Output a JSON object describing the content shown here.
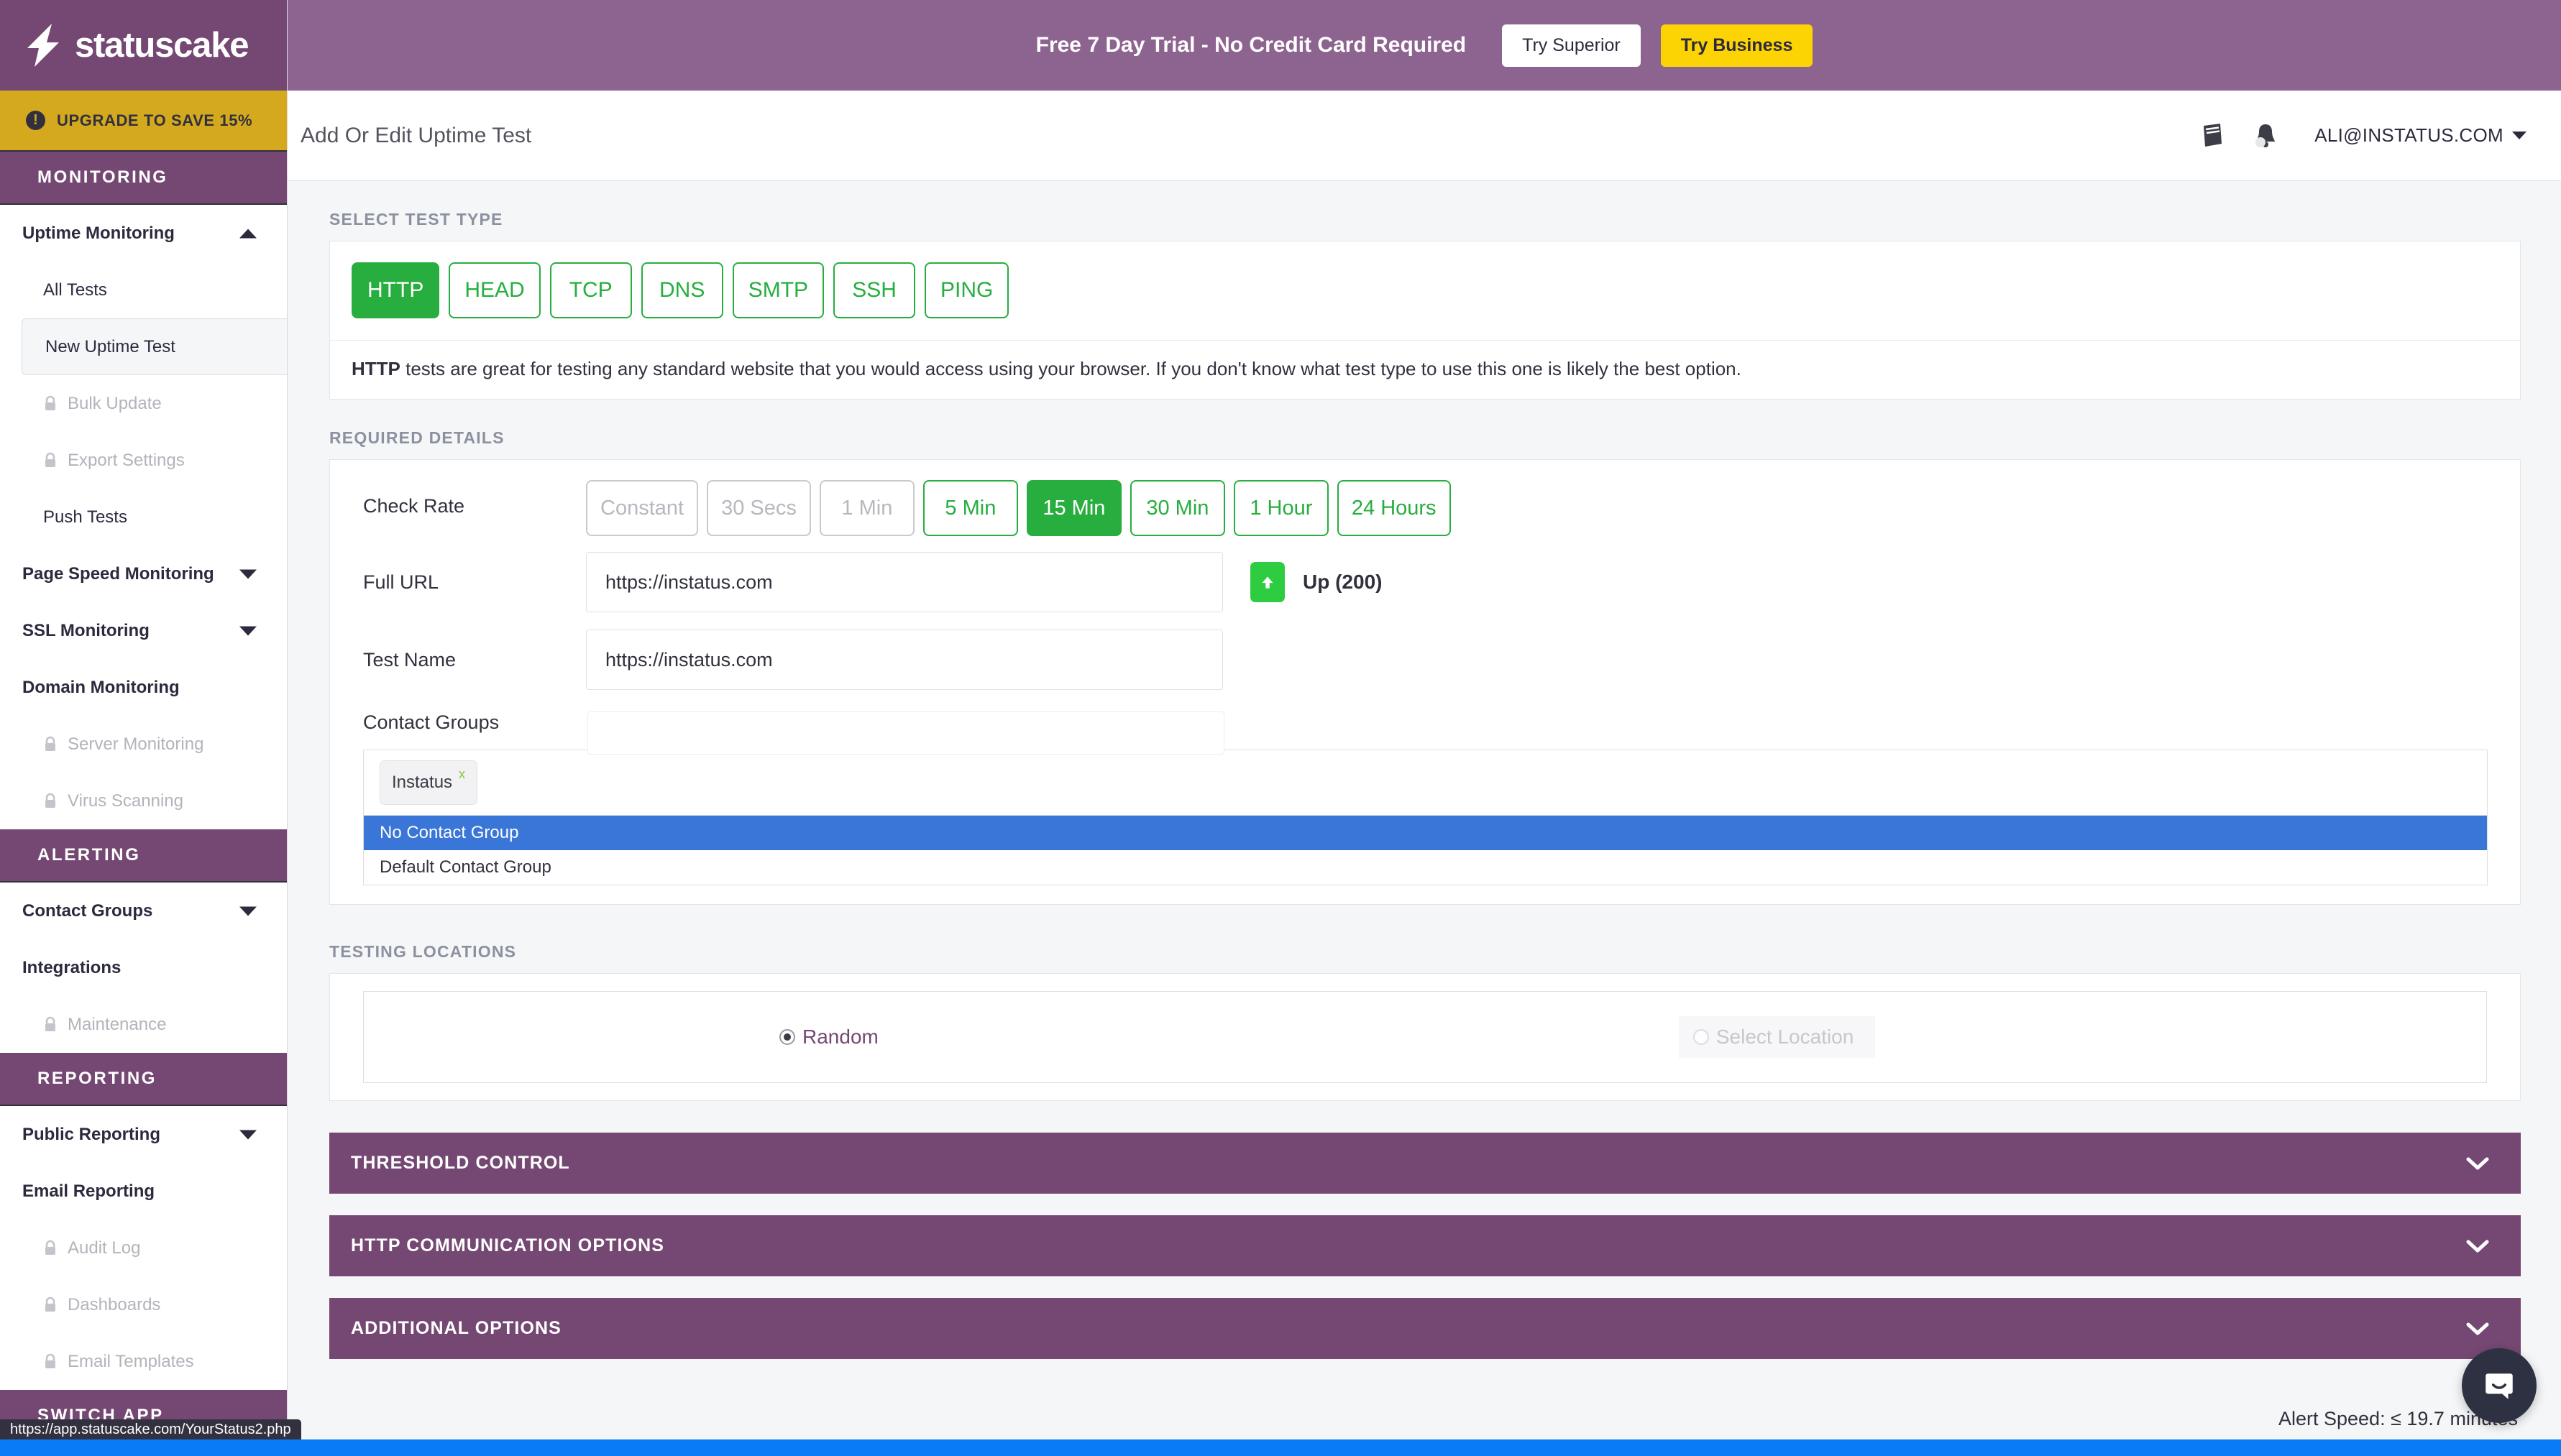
{
  "brand": {
    "name": "statuscake",
    "purple": "#744873",
    "gold": "#d4a91e",
    "green": "#27ae3f",
    "blue": "#3a76d8"
  },
  "sidebar": {
    "upgrade_label": "UPGRADE TO SAVE 15%",
    "groups": [
      {
        "heading": "MONITORING",
        "items": [
          {
            "label": "Uptime Monitoring",
            "level": "top",
            "caret": "up",
            "locked": false,
            "active": false
          },
          {
            "label": "All Tests",
            "level": "sub",
            "caret": "none",
            "locked": false,
            "active": false
          },
          {
            "label": "New Uptime Test",
            "level": "sub",
            "caret": "none",
            "locked": false,
            "active": true
          },
          {
            "label": "Bulk Update",
            "level": "sub",
            "caret": "none",
            "locked": true,
            "active": false
          },
          {
            "label": "Export Settings",
            "level": "sub",
            "caret": "none",
            "locked": true,
            "active": false
          },
          {
            "label": "Push Tests",
            "level": "sub",
            "caret": "none",
            "locked": false,
            "active": false
          },
          {
            "label": "Page Speed Monitoring",
            "level": "top",
            "caret": "down",
            "locked": false,
            "active": false
          },
          {
            "label": "SSL Monitoring",
            "level": "top",
            "caret": "down",
            "locked": false,
            "active": false
          },
          {
            "label": "Domain Monitoring",
            "level": "top",
            "caret": "none",
            "locked": false,
            "active": false
          },
          {
            "label": "Server Monitoring",
            "level": "sub",
            "caret": "none",
            "locked": true,
            "active": false
          },
          {
            "label": "Virus Scanning",
            "level": "sub",
            "caret": "none",
            "locked": true,
            "active": false
          }
        ]
      },
      {
        "heading": "ALERTING",
        "items": [
          {
            "label": "Contact Groups",
            "level": "top",
            "caret": "down",
            "locked": false,
            "active": false
          },
          {
            "label": "Integrations",
            "level": "top",
            "caret": "none",
            "locked": false,
            "active": false
          },
          {
            "label": "Maintenance",
            "level": "sub",
            "caret": "none",
            "locked": true,
            "active": false
          }
        ]
      },
      {
        "heading": "REPORTING",
        "items": [
          {
            "label": "Public Reporting",
            "level": "top",
            "caret": "down",
            "locked": false,
            "active": false
          },
          {
            "label": "Email Reporting",
            "level": "top",
            "caret": "none",
            "locked": false,
            "active": false
          },
          {
            "label": "Audit Log",
            "level": "sub",
            "caret": "none",
            "locked": true,
            "active": false
          },
          {
            "label": "Dashboards",
            "level": "sub",
            "caret": "none",
            "locked": true,
            "active": false
          },
          {
            "label": "Email Templates",
            "level": "sub",
            "caret": "none",
            "locked": true,
            "active": false
          }
        ]
      },
      {
        "heading": "SWITCH APP",
        "items": []
      }
    ]
  },
  "trial_banner": {
    "message": "Free 7 Day Trial - No Credit Card Required",
    "superior_label": "Try Superior",
    "business_label": "Try Business"
  },
  "header": {
    "page_title": "Add Or Edit Uptime Test",
    "user_email": "ALI@INSTATUS.COM",
    "icons": [
      "book-icon",
      "bell-icon"
    ]
  },
  "select_test_type": {
    "section_label": "SELECT TEST TYPE",
    "types": [
      {
        "label": "HTTP",
        "active": true
      },
      {
        "label": "HEAD",
        "active": false
      },
      {
        "label": "TCP",
        "active": false
      },
      {
        "label": "DNS",
        "active": false
      },
      {
        "label": "SMTP",
        "active": false
      },
      {
        "label": "SSH",
        "active": false
      },
      {
        "label": "PING",
        "active": false
      }
    ],
    "description_bold": "HTTP",
    "description": " tests are great for testing any standard website that you would access using your browser. If you don't know what test type to use this one is likely the best option."
  },
  "required_details": {
    "section_label": "REQUIRED DETAILS",
    "check_rate": {
      "label": "Check Rate",
      "options": [
        {
          "label": "Constant",
          "state": "disabled"
        },
        {
          "label": "30 Secs",
          "state": "disabled"
        },
        {
          "label": "1 Min",
          "state": "disabled"
        },
        {
          "label": "5 Min",
          "state": "normal"
        },
        {
          "label": "15 Min",
          "state": "active"
        },
        {
          "label": "30 Min",
          "state": "normal"
        },
        {
          "label": "1 Hour",
          "state": "normal"
        },
        {
          "label": "24 Hours",
          "state": "normal"
        }
      ]
    },
    "full_url": {
      "label": "Full URL",
      "value": "https://instatus.com",
      "placeholder": "https://instatus.com",
      "status_text": "Up (200)"
    },
    "test_name": {
      "label": "Test Name",
      "value": "https://instatus.com",
      "placeholder": "https://instatus.com"
    },
    "contact_groups": {
      "label": "Contact Groups",
      "tags": [
        {
          "label": "Instatus",
          "remove": "x"
        }
      ],
      "options": [
        {
          "label": "No Contact Group",
          "selected": true
        },
        {
          "label": "Default Contact Group",
          "selected": false
        }
      ]
    }
  },
  "testing_locations": {
    "section_label": "TESTING LOCATIONS",
    "random_label": "Random",
    "select_location_label": "Select Location",
    "selected": "Random"
  },
  "panels": [
    {
      "title": "THRESHOLD CONTROL",
      "expanded": false
    },
    {
      "title": "HTTP COMMUNICATION OPTIONS",
      "expanded": false
    },
    {
      "title": "ADDITIONAL OPTIONS",
      "expanded": false
    }
  ],
  "footer": {
    "alert_speed": "Alert Speed: ≤ 19.7 minutes"
  },
  "status_bar": {
    "url": "https://app.statuscake.com/YourStatus2.php"
  }
}
